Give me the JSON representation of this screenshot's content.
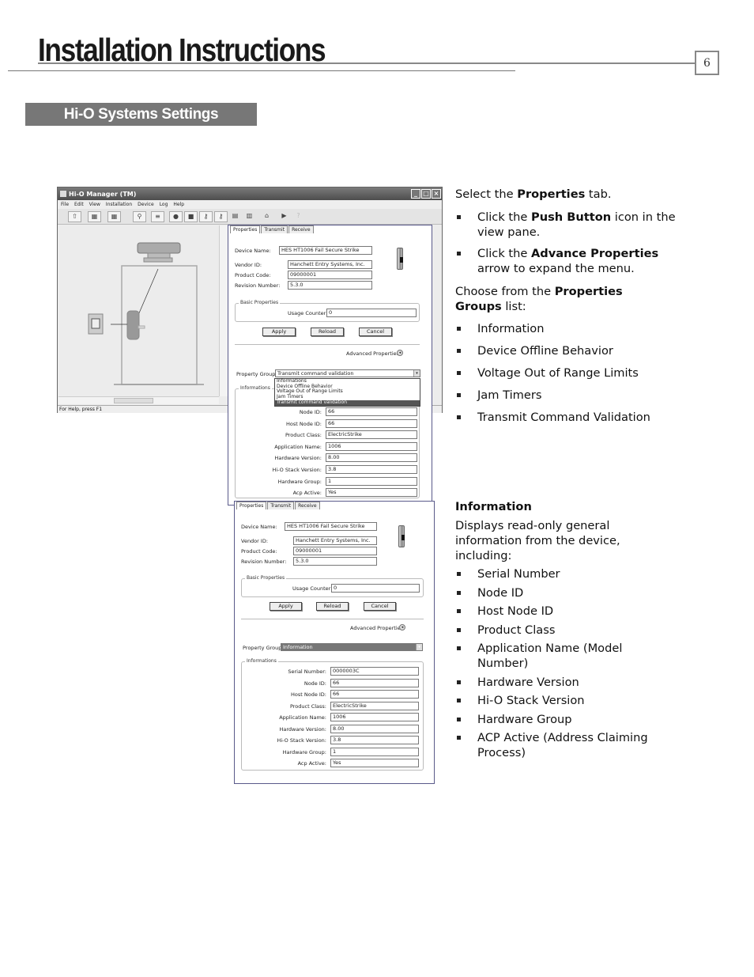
{
  "header": {
    "title": "Installation Instructions",
    "page_number": "6",
    "section": "Hi-O Systems Settings"
  },
  "app": {
    "title": "Hi-O Manager (TM)",
    "menu": [
      "File",
      "Edit",
      "View",
      "Installation",
      "Device",
      "Log",
      "Help"
    ],
    "status": "For Help, press F1",
    "window_buttons": [
      "_",
      "□",
      "×"
    ]
  },
  "panel1": {
    "tabs": [
      "Properties",
      "Transmit",
      "Receive"
    ],
    "device_name_label": "Device Name:",
    "device_name": "HES HT1006 Fail Secure Strike",
    "vendor_label": "Vendor ID:",
    "vendor": "Hanchett Entry Systems, Inc.",
    "product_code_label": "Product Code:",
    "product_code": "09000001",
    "revision_label": "Revision Number:",
    "revision": "5.3.0",
    "basic_group": "Basic Properties",
    "usage_label": "Usage Counter:",
    "usage": "0",
    "apply": "Apply",
    "reload": "Reload",
    "cancel": "Cancel",
    "advanced": "Advanced Properties",
    "groups_label": "Property Groups",
    "groups_selected": "Transmit command validation",
    "groups_options": [
      "Informations",
      "Device Offline Behavior",
      "Voltage Out of Range Limits",
      "Jam Timers",
      "Transmit command validation"
    ],
    "info_group": "Informations",
    "fields": [
      {
        "label": "Node ID:",
        "value": "66"
      },
      {
        "label": "Host Node ID:",
        "value": "66"
      },
      {
        "label": "Product Class:",
        "value": "ElectricStrike"
      },
      {
        "label": "Application Name:",
        "value": "1006"
      },
      {
        "label": "Hardware Version:",
        "value": "8.00"
      },
      {
        "label": "Hi-O Stack Version:",
        "value": "3.8"
      },
      {
        "label": "Hardware Group:",
        "value": "1"
      },
      {
        "label": "Acp Active:",
        "value": "Yes"
      }
    ]
  },
  "panel2": {
    "tabs": [
      "Properties",
      "Transmit",
      "Receive"
    ],
    "device_name_label": "Device Name:",
    "device_name": "HES HT1006 Fail Secure Strike",
    "vendor_label": "Vendor ID:",
    "vendor": "Hanchett Entry Systems, Inc.",
    "product_code_label": "Product Code:",
    "product_code": "09000001",
    "revision_label": "Revision Number:",
    "revision": "5.3.0",
    "basic_group": "Basic Properties",
    "usage_label": "Usage Counter:",
    "usage": "0",
    "apply": "Apply",
    "reload": "Reload",
    "cancel": "Cancel",
    "advanced": "Advanced Properties",
    "groups_label": "Property Groups",
    "groups_selected": "Information",
    "info_group": "Informations",
    "fields": [
      {
        "label": "Serial Number:",
        "value": "0000003C"
      },
      {
        "label": "Node ID:",
        "value": "66"
      },
      {
        "label": "Host Node ID:",
        "value": "66"
      },
      {
        "label": "Product Class:",
        "value": "ElectricStrike"
      },
      {
        "label": "Application Name:",
        "value": "1006"
      },
      {
        "label": "Hardware Version:",
        "value": "8.00"
      },
      {
        "label": "Hi-O Stack Version:",
        "value": "3.8"
      },
      {
        "label": "Hardware Group:",
        "value": "1"
      },
      {
        "label": "Acp Active:",
        "value": "Yes"
      }
    ]
  },
  "instructions": {
    "step1": {
      "pre": "Select the ",
      "bold": "Properties",
      "post": " tab."
    },
    "bullets": [
      {
        "pre": "Click the ",
        "bold": "Push Button",
        "post": " icon in the view pane."
      },
      {
        "pre": "Click the ",
        "bold": "Advance Properties",
        "post": " arrow to expand the menu."
      }
    ],
    "choose": {
      "pre": "Choose from the ",
      "bold": "Properties Groups",
      "post": " list:"
    },
    "groups": [
      "Information",
      "Device Offline Behavior",
      "Voltage Out of Range Limits",
      "Jam Timers",
      "Transmit Command Validation"
    ]
  },
  "information": {
    "heading": "Information",
    "description": "Displays read-only general information from the device, including:",
    "items": [
      "Serial Number",
      "Node ID",
      "Host Node ID",
      "Product Class",
      "Application Name (Model Number)",
      "Hardware Version",
      "Hi-O Stack Version",
      "Hardware Group",
      "ACP Active (Address Claiming Process)"
    ]
  }
}
